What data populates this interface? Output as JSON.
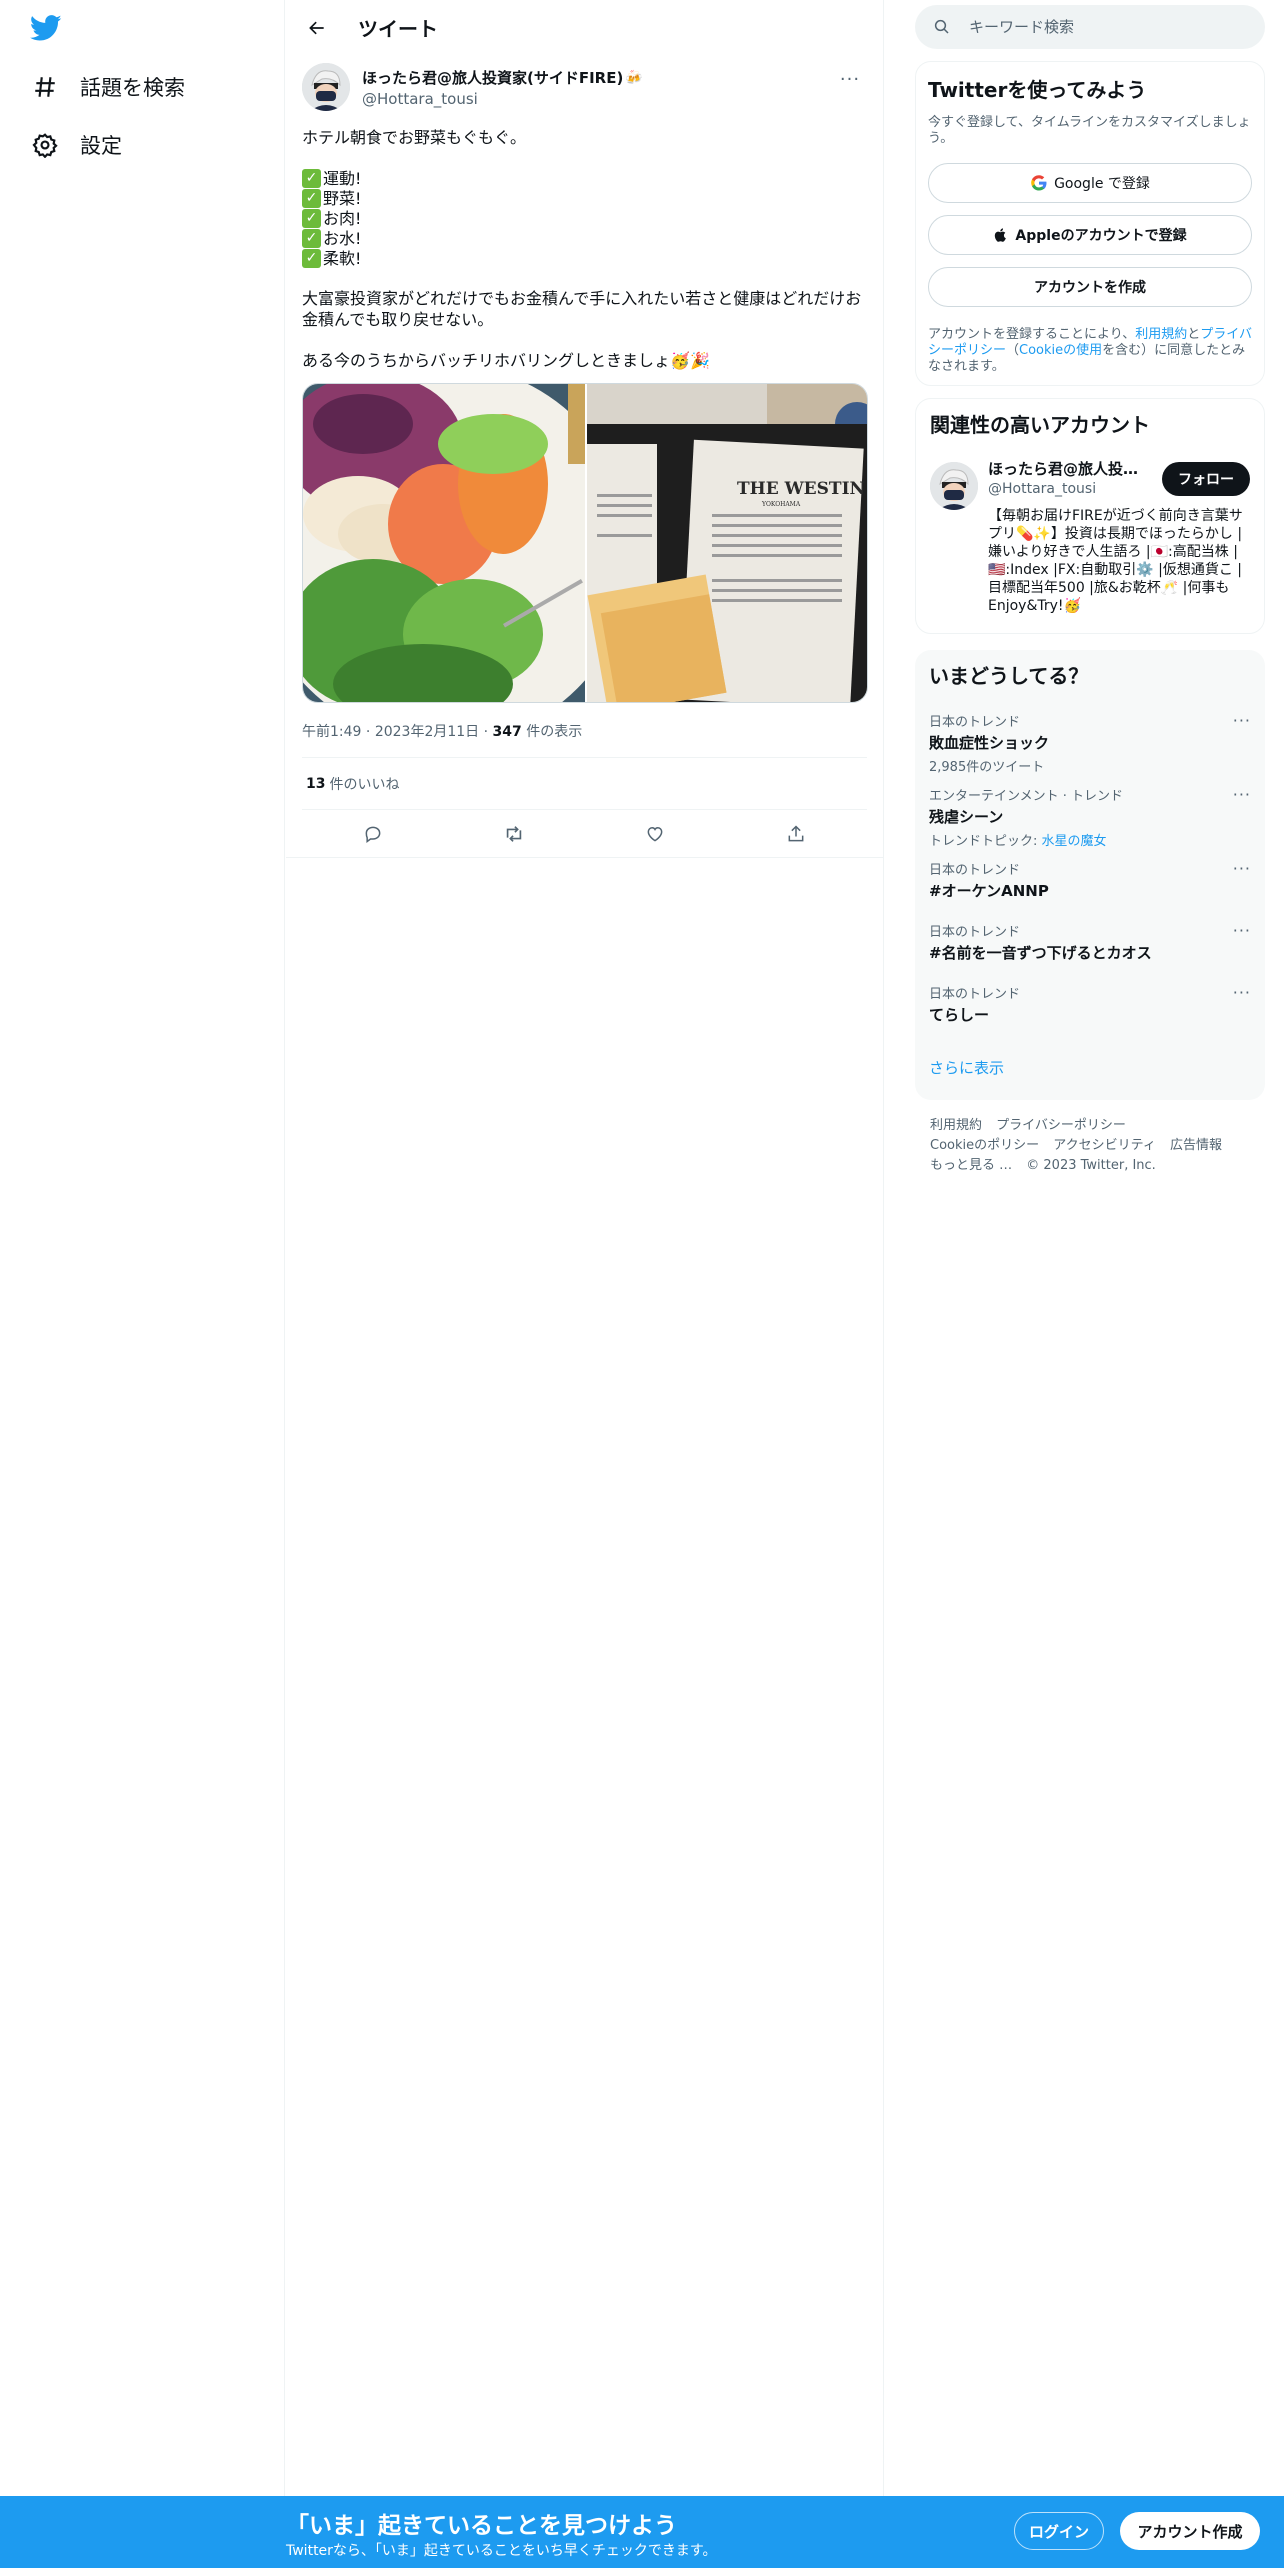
{
  "nav": {
    "explore_label": "話題を検索",
    "settings_label": "設定"
  },
  "header": {
    "title": "ツイート"
  },
  "tweet": {
    "author_name": "ほったら君@旅人投資家(サイドFIRE)",
    "author_handle": "@Hottara_tousi",
    "line1": "ホテル朝食でお野菜もぐもぐ。",
    "checklist": [
      "運動!",
      "野菜!",
      "お肉!",
      "お水!",
      "柔軟!"
    ],
    "line2": "大富豪投資家がどれだけでもお金積んで手に入れたい若さと健康はどれだけお金積んでも取り戻せない。",
    "line3": "ある今のうちからバッチリホバリングしときましょ",
    "menu_brand": "THE WESTIN",
    "menu_city": "YOKOHAMA",
    "time": "午前1:49",
    "date": "2023年2月11日",
    "views_count": "347",
    "views_label": "件の表示",
    "likes_count": "13",
    "likes_label": "件のいいね"
  },
  "search": {
    "placeholder": "キーワード検索"
  },
  "signup": {
    "title": "Twitterを使ってみよう",
    "desc": "今すぐ登録して、タイムラインをカスタマイズしましょう。",
    "google_label": "Google で登録",
    "apple_label": "Appleのアカウントで登録",
    "create_label": "アカウントを作成",
    "legal_prefix": "アカウントを登録することにより、",
    "legal_terms": "利用規約",
    "legal_and": "と",
    "legal_privacy": "プライバシーポリシー",
    "legal_paren_open": "（",
    "legal_cookie": "Cookieの使用",
    "legal_suffix": "を含む）に同意したとみなされます。"
  },
  "related": {
    "title": "関連性の高いアカウント",
    "name": "ほったら君@旅人投資家(サイドFIRE)",
    "handle": "@Hottara_tousi",
    "follow_label": "フォロー",
    "bio": "【毎朝お届けFIREが近づく前向き言葉サプリ💊✨】投資は長期でほったらかし |嫌いより好きで人生語ろ |🇯🇵:高配当株 |🇺🇸:Index |FX:自動取引⚙️ |仮想通貨こ |目標配当年500 |旅&お乾杯🥂 |何事もEnjoy&Try!🥳"
  },
  "trends": {
    "title": "いまどうしてる？",
    "items": [
      {
        "context": "日本のトレンド",
        "name": "敗血症性ショック",
        "sub": "2,985件のツイート"
      },
      {
        "context": "エンターテインメント · トレンド",
        "name": "残虐シーン",
        "sub_prefix": "トレンドトピック: ",
        "sub_link": "水星の魔女"
      },
      {
        "context": "日本のトレンド",
        "name": "#オーケンANNP"
      },
      {
        "context": "日本のトレンド",
        "name": "#名前を一音ずつ下げるとカオス"
      },
      {
        "context": "日本のトレンド",
        "name": "てらしー"
      }
    ],
    "show_more": "さらに表示"
  },
  "footer": {
    "terms": "利用規約",
    "privacy": "プライバシーポリシー",
    "cookie": "Cookieのポリシー",
    "accessibility": "アクセシビリティ",
    "ads": "広告情報",
    "more": "もっと見る …",
    "copyright": "© 2023 Twitter, Inc."
  },
  "bottom_bar": {
    "title": "「いま」起きていることを見つけよう",
    "sub": "Twitterなら、「いま」起きていることをいち早くチェックできます。",
    "login_label": "ログイン",
    "signup_label": "アカウント作成"
  },
  "colors": {
    "accent": "#1d9bf0",
    "text": "#0f1419",
    "muted": "#536471",
    "check": "#6dbb3a"
  }
}
